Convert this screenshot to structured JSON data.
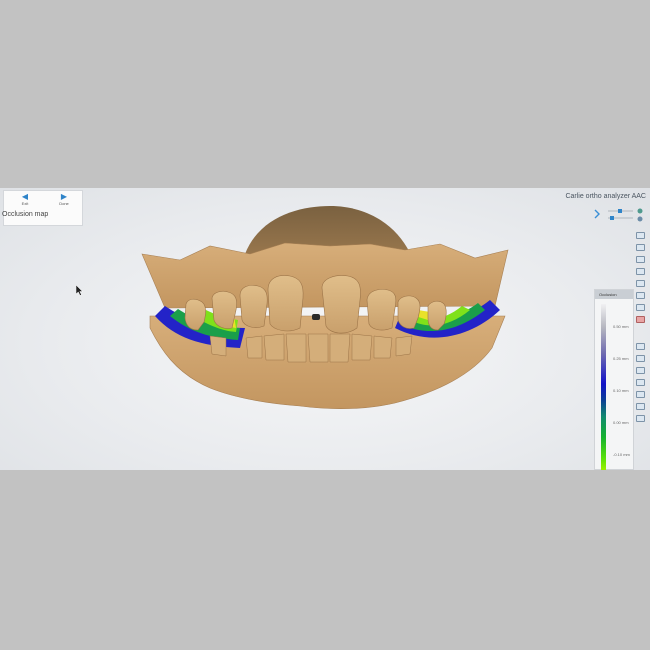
{
  "nav": {
    "exit_label": "Exit",
    "done_label": "Done"
  },
  "mode_label": "Occlusion map",
  "app_title": "Carlie ortho analyzer AAC",
  "toolbar": {
    "icons": [
      "view-top-icon",
      "view-front-icon",
      "view-left-icon",
      "view-right-icon",
      "view-bottom-icon",
      "view-back-icon",
      "section-icon",
      "color-icon",
      "measure-icon",
      "move-icon",
      "zoom-icon",
      "camera-icon",
      "rotate-icon",
      "undo-icon",
      "settings-icon"
    ]
  },
  "scale": {
    "header": "Occlusion",
    "ticks": [
      "0.50 mm",
      "0.25 mm",
      "0.10 mm",
      "0.00 mm",
      "-0.10 mm"
    ],
    "colors": [
      "#f0f0f2",
      "#1212c8",
      "#14b030",
      "#9cf000"
    ]
  }
}
